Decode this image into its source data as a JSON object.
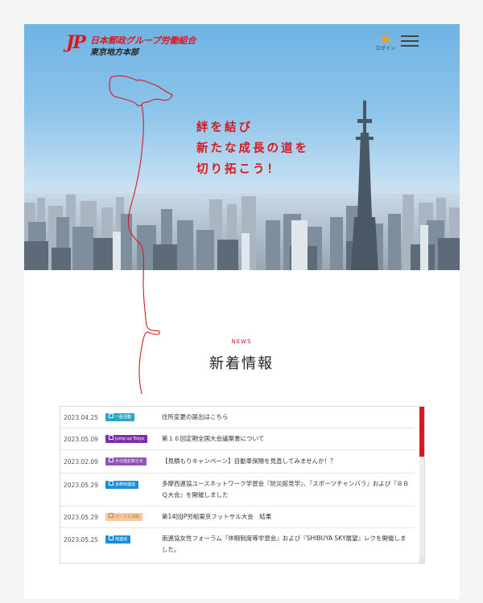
{
  "header": {
    "logo_mark": "JP",
    "org_name": "日本郵政グループ労働組合",
    "branch_name": "東京地方本部",
    "login_label": "ログイン"
  },
  "hero": {
    "tagline_lines": [
      "絆を結び",
      "新たな成長の道を",
      "切り拓こう！"
    ]
  },
  "news": {
    "eyebrow": "NEWS",
    "title": "新着情報",
    "items": [
      {
        "date": "2023.04.25",
        "tag": "一般活動",
        "tag_color": "#29a8c4",
        "text": "住所変更の届出はこちら"
      },
      {
        "date": "2023.05.09",
        "tag": "Jump up Tokyo",
        "tag_color": "#7b2fa8",
        "text": "第１６回定期全国大会議案書について"
      },
      {
        "date": "2023.02.09",
        "tag": "その他お知らせ",
        "tag_color": "#8e56b8",
        "text": "【見積もりキャンペーン】自動車保険を見直してみませんか！？"
      },
      {
        "date": "2023.05.29",
        "tag": "多摩西連協",
        "tag_color": "#1a8fd8",
        "text": "多摩西連協ユースネットワーク学習会『防災館見学』、『スポーツチャンバラ』および『ＢＢＱ大会』を開催しました"
      },
      {
        "date": "2023.05.29",
        "tag": "サークル活動",
        "tag_color": "#f5c9a0",
        "text": "第14回JP労組東京フットサル大会　結果"
      },
      {
        "date": "2023.05.25",
        "tag": "南連協",
        "tag_color": "#1a8fd8",
        "text": "南連協女性フォーラム『休暇制度等学習会』および『SHIBUYA SKY展望』レクを開催しました。"
      }
    ]
  },
  "colors": {
    "brand_red": "#d71920"
  }
}
